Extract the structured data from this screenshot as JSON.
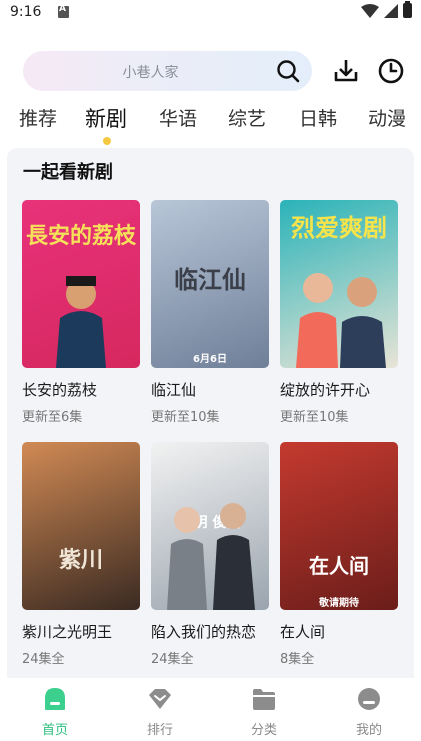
{
  "status_bar": {
    "time": "9:16"
  },
  "search": {
    "placeholder": "小巷人家"
  },
  "tabs": [
    {
      "label": "推荐"
    },
    {
      "label": "新剧",
      "active": true
    },
    {
      "label": "华语"
    },
    {
      "label": "综艺"
    },
    {
      "label": "日韩"
    },
    {
      "label": "动漫"
    }
  ],
  "section": {
    "title": "一起看新剧",
    "cards": [
      {
        "title": "长安的荔枝",
        "subtitle": "更新至6集",
        "poster_text": "長安的荔枝",
        "poster_bottom": "",
        "colors": [
          "#e8327a",
          "#d6285f"
        ]
      },
      {
        "title": "临江仙",
        "subtitle": "更新至10集",
        "poster_text": "临江仙",
        "poster_bottom": "6月6日",
        "colors": [
          "#b8c6d8",
          "#6f7f98"
        ]
      },
      {
        "title": "绽放的许开心",
        "subtitle": "更新至10集",
        "poster_text": "烈爱爽剧",
        "poster_bottom": "",
        "colors": [
          "#2ab3b8",
          "#e8e4d6"
        ]
      },
      {
        "title": "紫川之光明王",
        "subtitle": "24集全",
        "poster_text": "紫川",
        "poster_bottom": "",
        "colors": [
          "#d18a54",
          "#3a2a22"
        ]
      },
      {
        "title": "陷入我们的热恋",
        "subtitle": "24集全",
        "poster_text": "高明 俊倡",
        "poster_bottom": "",
        "colors": [
          "#f2f2f2",
          "#9aa4ae"
        ]
      },
      {
        "title": "在人间",
        "subtitle": "8集全",
        "poster_text": "在人间",
        "poster_bottom": "敬请期待",
        "colors": [
          "#c43a2f",
          "#6b1d1a"
        ]
      }
    ]
  },
  "bottom_nav": [
    {
      "label": "首页",
      "icon": "home-icon",
      "active": true
    },
    {
      "label": "排行",
      "icon": "ranking-icon"
    },
    {
      "label": "分类",
      "icon": "folder-icon"
    },
    {
      "label": "我的",
      "icon": "profile-icon"
    }
  ],
  "colors": {
    "accent": "#2bbf7f",
    "indicator": "#f5c842"
  }
}
